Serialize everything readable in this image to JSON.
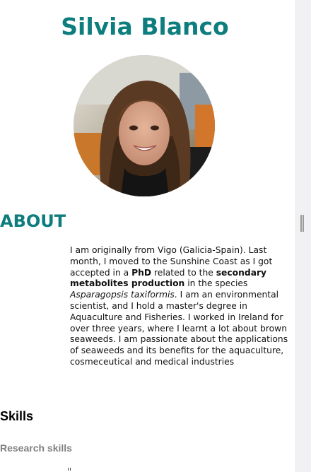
{
  "profile": {
    "name": "Silvia Blanco",
    "photo_icon": "portrait-photo"
  },
  "about": {
    "title": "ABOUT",
    "p1": "I am originally from Vigo (Galicia-Spain). Last month, I moved to the Sunshine Coast as I got accepted in a ",
    "b1": "PhD",
    "p2": " related to the ",
    "b2": "secondary metabolites production",
    "p3": " in the species ",
    "i1": "Asparagopsis taxiformis",
    "p4": ". I am an environmental scientist, and I hold a master's degree in Aquaculture and Fisheries. I worked in Ireland for over three years, where I learnt a lot about brown seaweeds. I am passionate about the applications of seaweeds and its benefits for the aquaculture, cosmeceutical and medical industries"
  },
  "skills": {
    "title": "Skills",
    "research_title": "Research skills"
  },
  "colors": {
    "accent": "#0e7d7d",
    "muted_heading": "#808080",
    "scroll_gutter": "#f1f1f3"
  }
}
